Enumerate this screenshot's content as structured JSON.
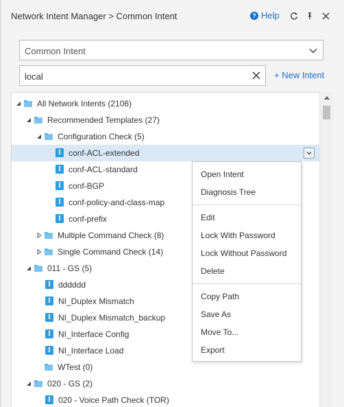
{
  "header": {
    "title": "Network Intent Manager > Common Intent",
    "help_label": "Help"
  },
  "filter": {
    "category_value": "Common Intent",
    "search_value": "local",
    "new_intent_label": "+ New Intent"
  },
  "tree": {
    "root": "All Network Intents (2106)",
    "recommended": "Recommended Templates (27)",
    "config_check": "Configuration Check (5)",
    "config_items": [
      "conf-ACL-extended",
      "conf-ACL-standard",
      "conf-BGP",
      "conf-policy-and-class-map",
      "conf-prefix"
    ],
    "multiple_cmd": "Multiple Command Check (8)",
    "single_cmd": "Single Command Check (14)",
    "gs011": "011 - GS (5)",
    "gs011_items": [
      "dddddd",
      "NI_Duplex Mismatch",
      "NI_Duplex Mismatch_backup",
      "NI_Interface Config",
      "NI_Interface Load"
    ],
    "wtest": "WTest (0)",
    "gs020": "020 - GS (2)",
    "gs020_item": "020 - Voice Path Check (TOR)"
  },
  "context_menu": {
    "items": [
      "Open Intent",
      "Diagnosis Tree",
      "Edit",
      "Lock With Password",
      "Lock Without Password",
      "Delete",
      "Copy Path",
      "Save As",
      "Move To...",
      "Export"
    ]
  },
  "colors": {
    "accent": "#1a6fc9",
    "folder": "#5ab0e6",
    "intent_icon": "#2f9be0",
    "selection": "#dbe9f7"
  }
}
